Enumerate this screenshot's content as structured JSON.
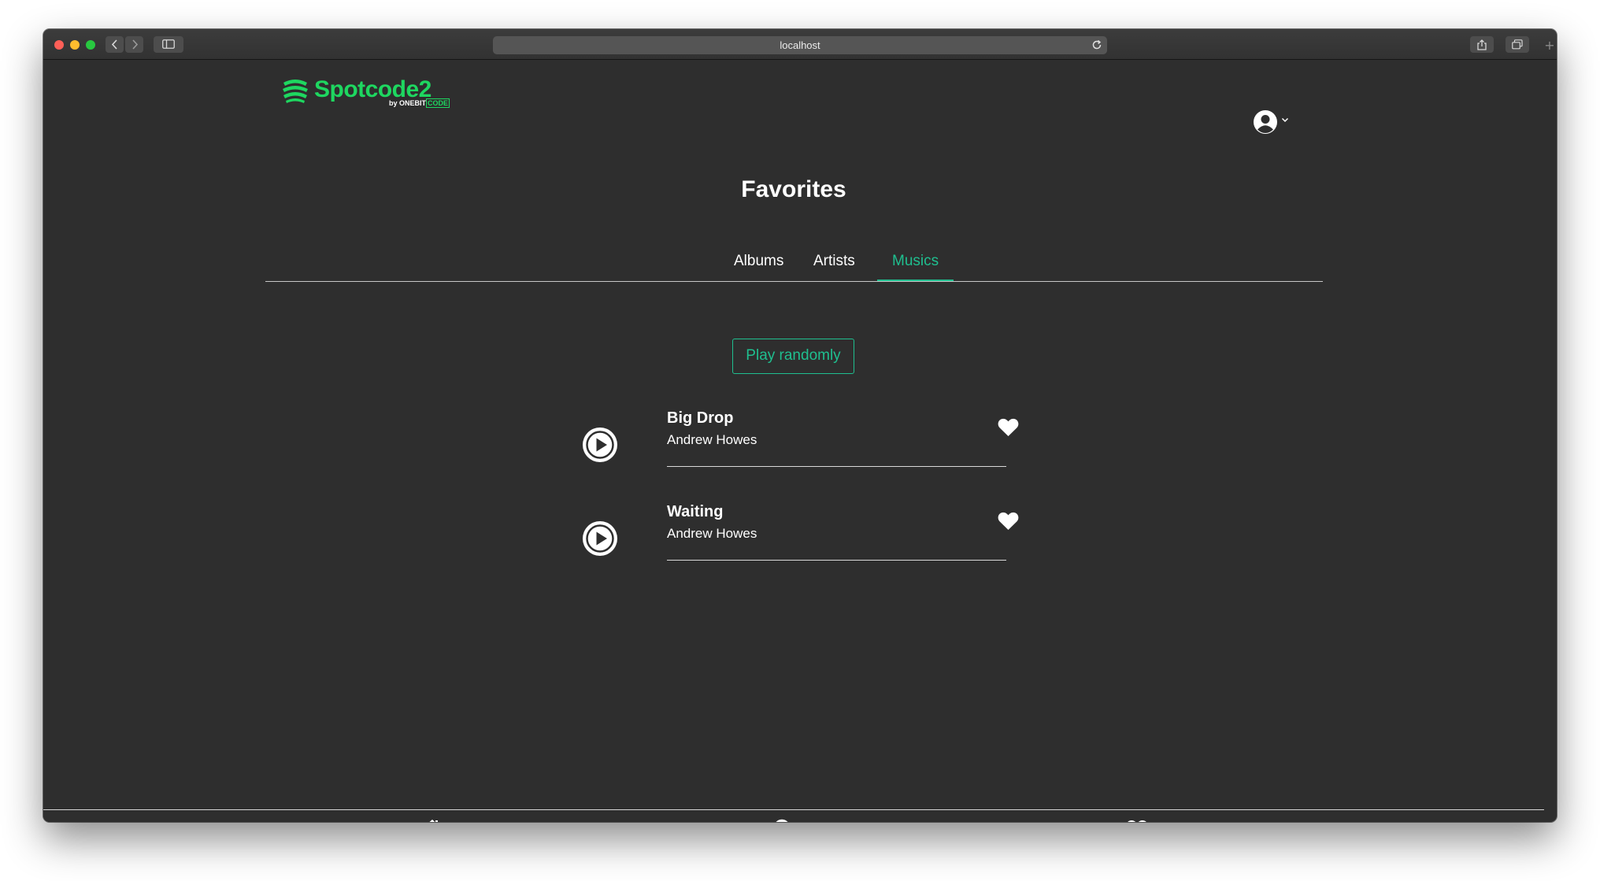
{
  "browser": {
    "url": "localhost"
  },
  "header": {
    "logo_text": "Spotcode2",
    "logo_by": "by",
    "logo_brand": "ONEBIT",
    "logo_brand_code": "CODE",
    "user_icon": "user-circle-icon",
    "dropdown_icon": "chevron-down-icon"
  },
  "page": {
    "title": "Favorites"
  },
  "tabs": [
    {
      "label": "Albums",
      "active": false
    },
    {
      "label": "Artists",
      "active": false
    },
    {
      "label": "Musics",
      "active": true
    }
  ],
  "actions": {
    "play_randomly_label": "Play randomly"
  },
  "tracks": [
    {
      "title": "Big Drop",
      "artist": "Andrew Howes",
      "favorite": true
    },
    {
      "title": "Waiting",
      "artist": "Andrew Howes",
      "favorite": true
    }
  ],
  "bottom_nav": [
    {
      "icon": "home-icon"
    },
    {
      "icon": "search-icon"
    },
    {
      "icon": "heart-icon"
    }
  ],
  "colors": {
    "accent": "#1fbf8f",
    "brand": "#1ed760",
    "background": "#2e2e2e",
    "text": "#ffffff"
  }
}
